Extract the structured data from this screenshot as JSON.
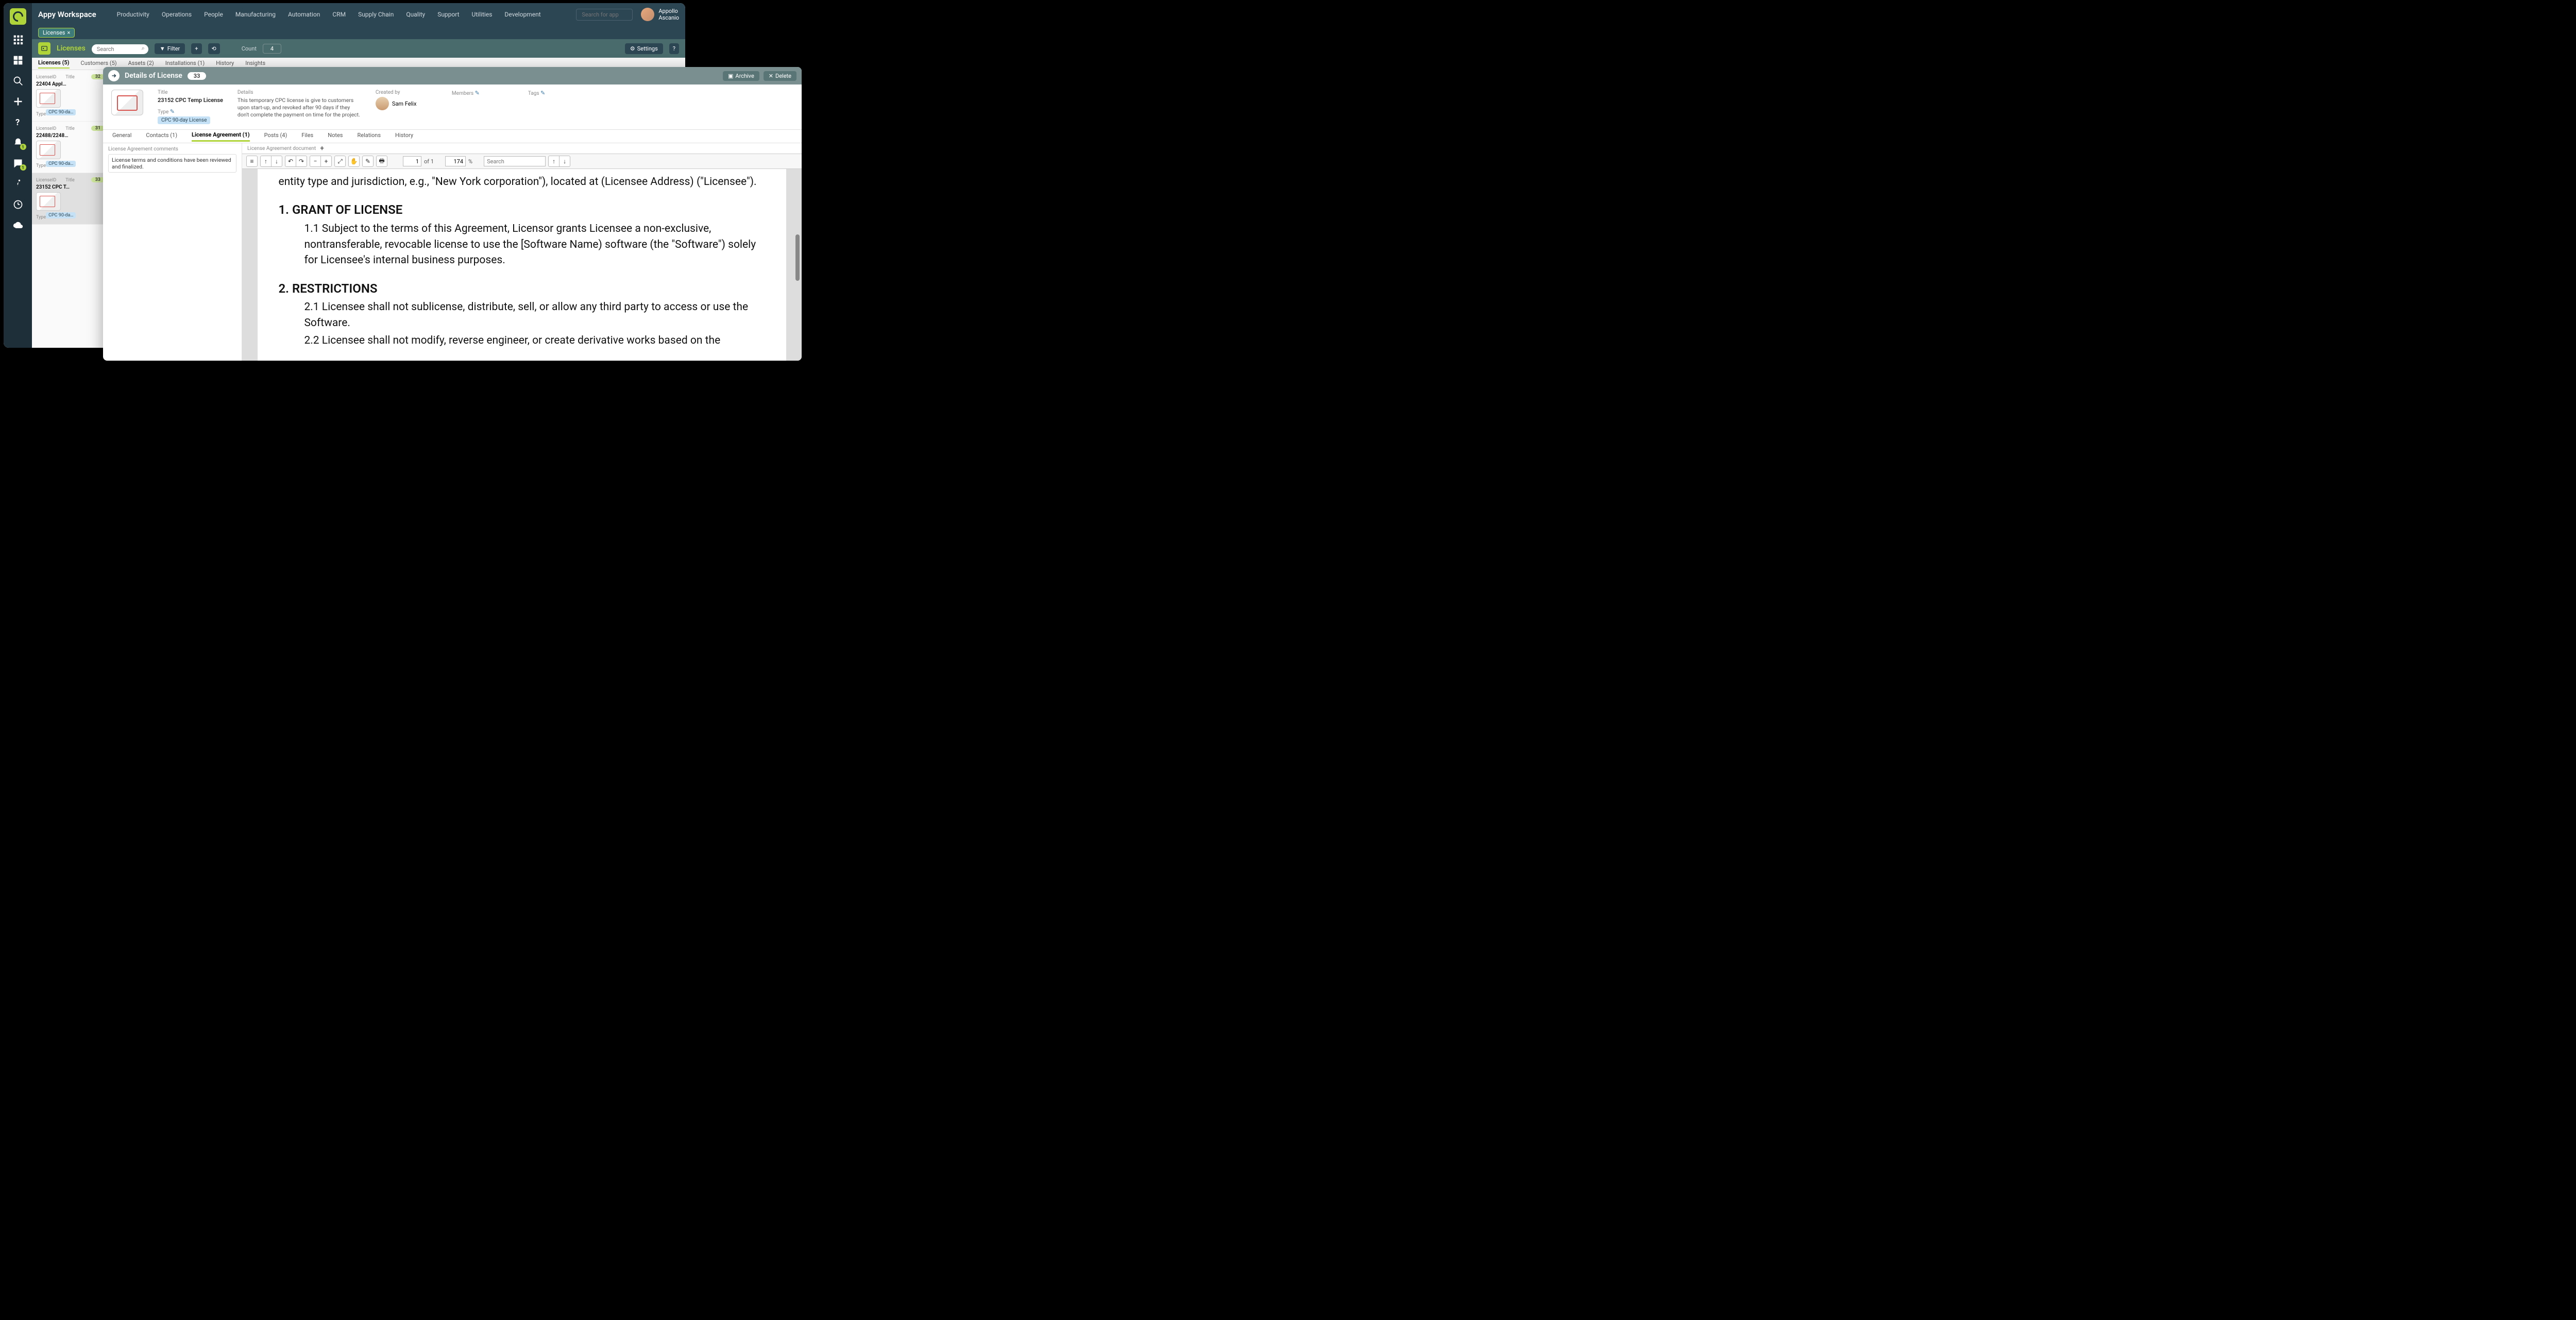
{
  "workspace": {
    "title": "Appy Workspace"
  },
  "top_nav": [
    "Productivity",
    "Operations",
    "People",
    "Manufacturing",
    "Automation",
    "CRM",
    "Supply Chain",
    "Quality",
    "Support",
    "Utilities",
    "Development"
  ],
  "search_app": {
    "placeholder": "Search for app"
  },
  "user": {
    "first": "Appollo",
    "last": "Ascanio"
  },
  "chip": {
    "label": "Licenses",
    "close": "×"
  },
  "module": {
    "title": "Licenses",
    "search_placeholder": "Search",
    "filter": "Filter",
    "count_label": "Count",
    "count_value": "4",
    "settings": "Settings",
    "help": "?"
  },
  "tabs": [
    {
      "label": "Licenses (5)",
      "active": true
    },
    {
      "label": "Customers (5)"
    },
    {
      "label": "Assets (2)"
    },
    {
      "label": "Installations (1)"
    },
    {
      "label": "History"
    },
    {
      "label": "Insights"
    }
  ],
  "list_labels": {
    "id": "LicenseID",
    "title": "Title",
    "type": "Type"
  },
  "licenses": [
    {
      "id": "32",
      "title": "22404 Appl…",
      "type": "CPC 90-da…"
    },
    {
      "id": "31",
      "title": "22488/2248…",
      "type": "CPC 90-da…"
    },
    {
      "id": "33",
      "title": "23152 CPC T…",
      "type": "CPC 90-da…",
      "selected": true
    }
  ],
  "detail": {
    "header": "Details of License",
    "id": "33",
    "archive": "Archive",
    "delete": "Delete",
    "title_label": "Title",
    "title": "23152 CPC Temp License",
    "type_label": "Type",
    "type": "CPC 90-day License",
    "details_label": "Details",
    "details": "This temporary CPC license is give to customers upon start-up, and revoked after 90 days if they don't complete the payment on time for the project.",
    "created_label": "Created by",
    "created_by": "Sam Felix",
    "members_label": "Members",
    "tags_label": "Tags"
  },
  "detail_tabs": [
    {
      "label": "General"
    },
    {
      "label": "Contacts (1)"
    },
    {
      "label": "License Agreement (1)",
      "active": true
    },
    {
      "label": "Posts (4)"
    },
    {
      "label": "Files"
    },
    {
      "label": "Notes"
    },
    {
      "label": "Relations"
    },
    {
      "label": "History"
    }
  ],
  "comments": {
    "label": "License Agreement comments",
    "text": "License terms and conditions have been reviewed and finalized."
  },
  "doc": {
    "label": "License Agreement document",
    "page": "1",
    "total_pages": "of 1",
    "zoom": "174",
    "zoom_pct": "%",
    "search_placeholder": "Search",
    "p0": "entity type and jurisdiction, e.g., \"New York corporation\"), located at (Licensee Address) (\"Licensee\").",
    "h1": "1. GRANT OF LICENSE",
    "p1": "1.1 Subject to the terms of this Agreement, Licensor grants Licensee a non-exclusive, nontransferable, revocable license to use the [Software Name) software (the \"Software\") solely for Licensee's internal business purposes.",
    "h2": "2. RESTRICTIONS",
    "p2a": "2.1 Licensee shall not sublicense, distribute, sell, or allow any third party to access or use the Software.",
    "p2b": "2.2 Licensee shall not modify, reverse engineer, or create derivative works based on the"
  },
  "left_nav_badges": {
    "bell": "1",
    "chat": "1"
  }
}
